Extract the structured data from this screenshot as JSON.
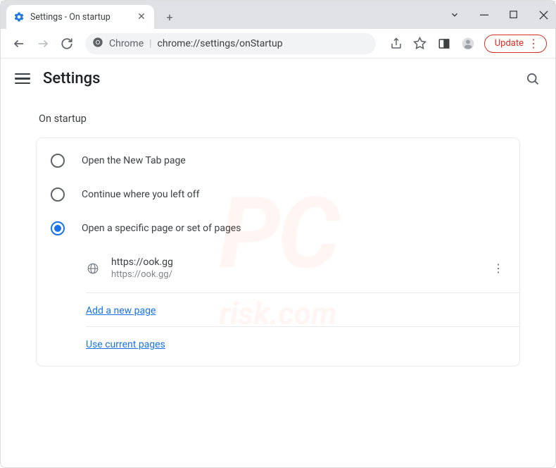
{
  "tab": {
    "title": "Settings - On startup"
  },
  "addressbar": {
    "origin_label": "Chrome",
    "url": "chrome://settings/onStartup"
  },
  "update_button": {
    "label": "Update"
  },
  "header": {
    "title": "Settings"
  },
  "section": {
    "title": "On startup"
  },
  "radios": {
    "new_tab": "Open the New Tab page",
    "continue": "Continue where you left off",
    "specific": "Open a specific page or set of pages"
  },
  "startup_page": {
    "title": "https://ook.gg",
    "url": "https://ook.gg/"
  },
  "links": {
    "add_page": "Add a new page",
    "use_current": "Use current pages"
  },
  "watermark": {
    "main": "PC",
    "sub": "risk.com"
  }
}
